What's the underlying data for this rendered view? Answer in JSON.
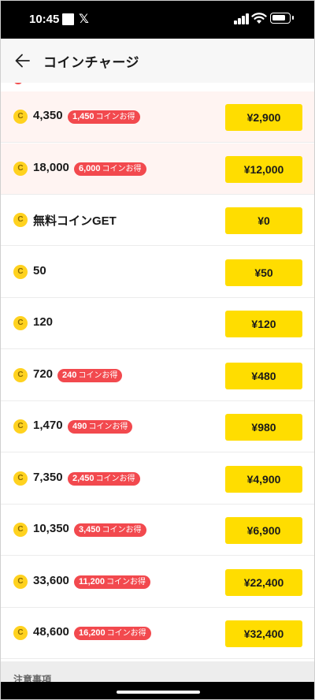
{
  "status_bar": {
    "time": "10:45",
    "x_app_glyph": "𝕏",
    "battery_level": 0.85
  },
  "header": {
    "back_icon": "arrow-left-icon",
    "title": "コインチャージ"
  },
  "coin_icon_letter": "C",
  "rows": [
    {
      "amount": "4,350",
      "bonus": "1,450",
      "bonus_suffix": "コインお得",
      "price": "¥2,900",
      "highlight": true
    },
    {
      "amount": "18,000",
      "bonus": "6,000",
      "bonus_suffix": "コインお得",
      "price": "¥12,000",
      "highlight": true
    },
    {
      "amount": "無料コインGET",
      "bonus": "",
      "bonus_suffix": "",
      "price": "¥0",
      "highlight": false
    },
    {
      "amount": "50",
      "bonus": "",
      "bonus_suffix": "",
      "price": "¥50",
      "highlight": false
    },
    {
      "amount": "120",
      "bonus": "",
      "bonus_suffix": "",
      "price": "¥120",
      "highlight": false
    },
    {
      "amount": "720",
      "bonus": "240",
      "bonus_suffix": "コインお得",
      "price": "¥480",
      "highlight": false
    },
    {
      "amount": "1,470",
      "bonus": "490",
      "bonus_suffix": "コインお得",
      "price": "¥980",
      "highlight": false
    },
    {
      "amount": "7,350",
      "bonus": "2,450",
      "bonus_suffix": "コインお得",
      "price": "¥4,900",
      "highlight": false
    },
    {
      "amount": "10,350",
      "bonus": "3,450",
      "bonus_suffix": "コインお得",
      "price": "¥6,900",
      "highlight": false
    },
    {
      "amount": "33,600",
      "bonus": "11,200",
      "bonus_suffix": "コインお得",
      "price": "¥22,400",
      "highlight": false
    },
    {
      "amount": "48,600",
      "bonus": "16,200",
      "bonus_suffix": "コインお得",
      "price": "¥32,400",
      "highlight": false
    }
  ],
  "notes": {
    "title": "注意事項"
  },
  "colors": {
    "accent_yellow": "#ffdd00",
    "bonus_red": "#f2494e",
    "highlight_bg": "#fff4f2",
    "coin_gold": "#ffd21f"
  }
}
